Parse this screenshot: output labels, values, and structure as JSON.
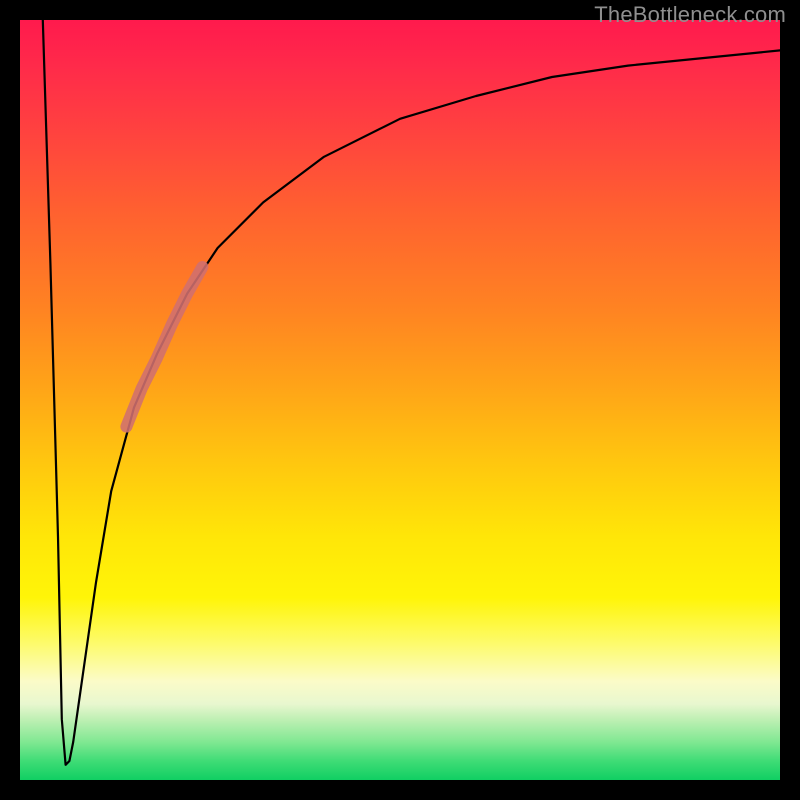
{
  "watermark": "TheBottleneck.com",
  "colors": {
    "frame": "#000000",
    "curve": "#000000",
    "highlight": "#d07070",
    "watermark": "#8f8f8f"
  },
  "chart_data": {
    "type": "line",
    "title": "",
    "xlabel": "",
    "ylabel": "",
    "xlim": [
      0,
      100
    ],
    "ylim": [
      0,
      100
    ],
    "grid": false,
    "legend": false,
    "annotations": [
      {
        "text": "TheBottleneck.com",
        "position": "top-right"
      }
    ],
    "series": [
      {
        "name": "bottleneck-curve",
        "x": [
          3,
          4,
          5,
          5.5,
          6,
          6.5,
          7,
          8,
          10,
          12,
          15,
          18,
          22,
          26,
          32,
          40,
          50,
          60,
          70,
          80,
          90,
          100
        ],
        "values": [
          100,
          68,
          32,
          8,
          2,
          2.5,
          5,
          12,
          26,
          38,
          49,
          56,
          64,
          70,
          76,
          82,
          87,
          90,
          92.5,
          94,
          95,
          96
        ]
      },
      {
        "name": "highlight-segment",
        "x": [
          14,
          16,
          18,
          20,
          22,
          24
        ],
        "values": [
          46.5,
          51.5,
          55.5,
          60,
          64,
          67.5
        ]
      }
    ]
  }
}
